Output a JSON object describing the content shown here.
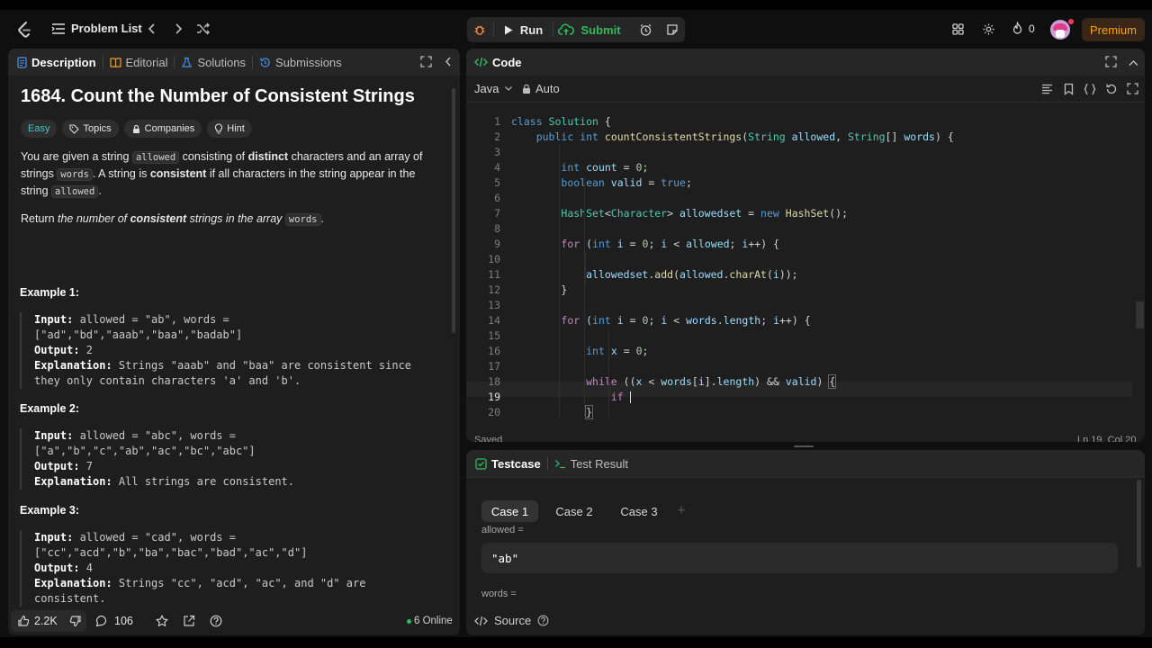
{
  "topbar": {
    "problem_list": "Problem List",
    "run": "Run",
    "submit": "Submit",
    "streak": "0",
    "premium": "Premium"
  },
  "desc": {
    "tabs": [
      "Description",
      "Editorial",
      "Solutions",
      "Submissions"
    ],
    "title": "1684. Count the Number of Consistent Strings",
    "difficulty": "Easy",
    "chips": [
      "Topics",
      "Companies",
      "Hint"
    ],
    "p1": {
      "a": "You are given a string ",
      "code1": "allowed",
      "b": " consisting of ",
      "bold1": "distinct",
      "c": " characters and an array of strings ",
      "code2": "words",
      "d": ". A string is ",
      "bold2": "consistent",
      "e": " if all characters in the string appear in the string ",
      "code3": "allowed",
      "f": "."
    },
    "p2": {
      "a": "Return ",
      "i1": "the number of ",
      "b1": "consistent",
      "i2": " strings in the array ",
      "code": "words",
      "end": "."
    },
    "examples": [
      {
        "title": "Example 1:",
        "input_label": "Input:",
        "input": " allowed = \"ab\", words =",
        "input2": "[\"ad\",\"bd\",\"aaab\",\"baa\",\"badab\"]",
        "output_label": "Output:",
        "output": " 2",
        "expl_label": "Explanation:",
        "expl": " Strings \"aaab\" and \"baa\" are consistent since",
        "expl2": "they only contain characters 'a' and 'b'."
      },
      {
        "title": "Example 2:",
        "input_label": "Input:",
        "input": " allowed = \"abc\", words =",
        "input2": "[\"a\",\"b\",\"c\",\"ab\",\"ac\",\"bc\",\"abc\"]",
        "output_label": "Output:",
        "output": " 7",
        "expl_label": "Explanation:",
        "expl": " All strings are consistent.",
        "expl2": ""
      },
      {
        "title": "Example 3:",
        "input_label": "Input:",
        "input": " allowed = \"cad\", words =",
        "input2": "[\"cc\",\"acd\",\"b\",\"ba\",\"bac\",\"bad\",\"ac\",\"d\"]",
        "output_label": "Output:",
        "output": " 4",
        "expl_label": "Explanation:",
        "expl": " Strings \"cc\", \"acd\", \"ac\", and \"d\" are",
        "expl2": "consistent."
      }
    ],
    "footer": {
      "likes": "2.2K",
      "comments": "106",
      "online": "6 Online"
    }
  },
  "code": {
    "tab": "Code",
    "language": "Java",
    "mode": "Auto",
    "status": "Saved",
    "cursor": "Ln 19, Col 20",
    "line_numbers": [
      "1",
      "2",
      "3",
      "4",
      "5",
      "6",
      "7",
      "8",
      "9",
      "10",
      "11",
      "12",
      "13",
      "14",
      "15",
      "16",
      "17",
      "18",
      "19",
      "20"
    ]
  },
  "testcase": {
    "tabs": [
      "Testcase",
      "Test Result"
    ],
    "cases": [
      "Case 1",
      "Case 2",
      "Case 3"
    ],
    "add": "+",
    "field1_label": "allowed =",
    "field1_value": "\"ab\"",
    "field2_label": "words =",
    "source": "Source"
  },
  "colors": {
    "accent_green": "#2cbb5d",
    "premium": "#ffa116",
    "easy": "#46c6c2"
  }
}
